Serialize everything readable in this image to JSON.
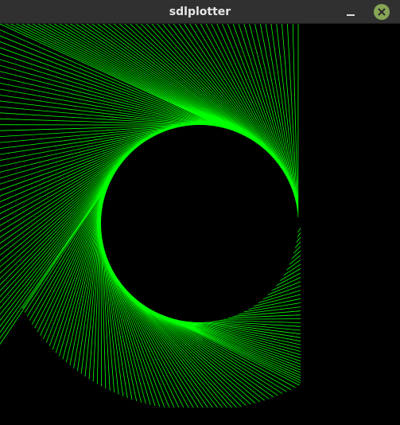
{
  "window": {
    "title": "sdlplotter"
  },
  "controls": {
    "minimize_icon": "minimize-icon",
    "close_icon": "close-icon"
  },
  "plot": {
    "line_color": "#00ff00",
    "background_color": "#000000"
  },
  "colors": {
    "titlebar": "#303030",
    "close_button": "#87a556"
  }
}
